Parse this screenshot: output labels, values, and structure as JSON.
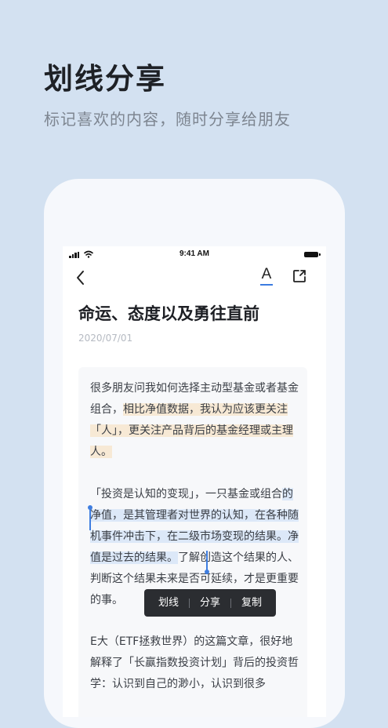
{
  "hero": {
    "title": "划线分享",
    "subtitle": "标记喜欢的内容，随时分享给朋友"
  },
  "status_bar": {
    "time": "9:41 AM"
  },
  "nav": {
    "back_icon": "chevron-left-icon",
    "font_icon": "font-settings-icon",
    "font_glyph": "A",
    "share_icon": "share-icon",
    "accent_color": "#3b7be0"
  },
  "article": {
    "title": "命运、态度以及勇往直前",
    "date": "2020/07/01",
    "p1": {
      "plain": "很多朋友问我如何选择主动型基金或者基金组合，",
      "highlighted": "相比净值数据，我认为应该更关注「人」，更关注产品背后的基金经理或主理人。"
    },
    "p2": {
      "before": "「投资是认知的变现」，一只基金或组合",
      "selected": "的净值，是其管理者对世界的认知，在各种随机事件冲击下，在二级市场变现的结果。净值是过去的结果。",
      "after": "了解创造这个结果的人、判断这个结果未来是否可延续，才是更重要的事。"
    },
    "p3": {
      "text": "E大（ETF拯救世界）的这篇文章，很好地解释了「长赢指数投资计划」背后的投资哲学：认识到自己的渺小，认识到很多"
    }
  },
  "selection_menu": {
    "underline": "划线",
    "share": "分享",
    "copy": "复制"
  },
  "colors": {
    "background": "#d3e1f1",
    "highlight_orange": "#f7e9d5",
    "highlight_blue": "#dce8f8",
    "cursor": "#3f7ee0"
  }
}
